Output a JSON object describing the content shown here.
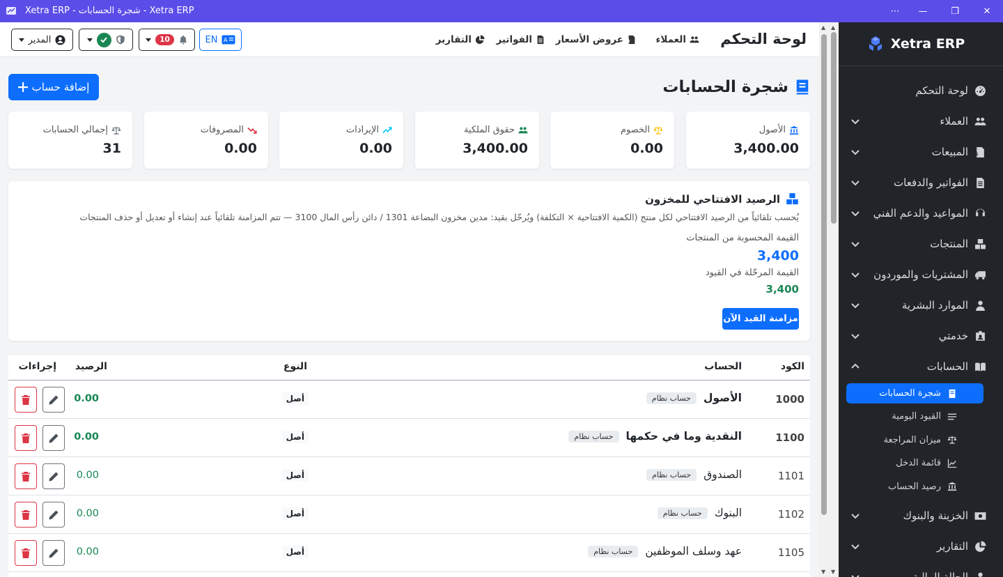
{
  "window": {
    "title": "Xetra ERP - شجرة الحسابات - Xetra ERP",
    "controls": [
      "⋯",
      "—",
      "❐",
      "✕"
    ]
  },
  "sidebar": {
    "brand": "Xetra ERP",
    "items": [
      {
        "label": "لوحة التحكم",
        "icon": "gauge-icon",
        "chevron": false
      },
      {
        "label": "العملاء",
        "icon": "users-icon",
        "chevron": "down"
      },
      {
        "label": "المبيعات",
        "icon": "file-dollar-icon",
        "chevron": "down"
      },
      {
        "label": "الفواتير والدفعات",
        "icon": "invoice-icon",
        "chevron": "down"
      },
      {
        "label": "المواعيد والدعم الفني",
        "icon": "headset-icon",
        "chevron": "down"
      },
      {
        "label": "المنتجات",
        "icon": "boxes-icon",
        "chevron": "down"
      },
      {
        "label": "المشتريات والموردون",
        "icon": "truck-icon",
        "chevron": "down"
      },
      {
        "label": "الموارد البشرية",
        "icon": "user-tie-icon",
        "chevron": "down"
      },
      {
        "label": "خدمتي",
        "icon": "id-badge-icon",
        "chevron": "down"
      },
      {
        "label": "الحسابات",
        "icon": "book-open-icon",
        "chevron": "up"
      }
    ],
    "sub_items": [
      {
        "label": "شجرة الحسابات",
        "icon": "book-icon",
        "active": true
      },
      {
        "label": "القيود اليومية",
        "icon": "list-icon",
        "active": false
      },
      {
        "label": "ميزان المراجعة",
        "icon": "scale-icon",
        "active": false
      },
      {
        "label": "قائمة الدخل",
        "icon": "chart-line-icon",
        "active": false
      },
      {
        "label": "رصيد الحساب",
        "icon": "bank-icon",
        "active": false
      }
    ],
    "items_after": [
      {
        "label": "الخزينة والبنوك",
        "icon": "money-icon",
        "chevron": "down"
      },
      {
        "label": "التقارير",
        "icon": "pie-chart-icon",
        "chevron": "down"
      },
      {
        "label": "الحالة المالية",
        "icon": "person-icon",
        "chevron": "down"
      }
    ]
  },
  "topbar": {
    "page_title": "لوحة التحكم",
    "nav": [
      {
        "label": "العملاء",
        "icon": "users-icon"
      },
      {
        "label": "عروض الأسعار",
        "icon": "file-dollar-icon"
      },
      {
        "label": "الفواتير",
        "icon": "invoice-icon"
      },
      {
        "label": "التقارير",
        "icon": "pie-chart-icon"
      }
    ],
    "lang_label": "EN",
    "notification_count": "10",
    "user_label": "المدير"
  },
  "page": {
    "title": "شجرة الحسابات",
    "add_button": "إضافة حساب"
  },
  "summary_cards": [
    {
      "label": "الأصول",
      "value": "3,400.00",
      "icon": "bank-icon",
      "color": "#0d6efd"
    },
    {
      "label": "الخصوم",
      "value": "0.00",
      "icon": "scale-icon",
      "color": "#ffc107"
    },
    {
      "label": "حقوق الملكية",
      "value": "3,400.00",
      "icon": "users-icon",
      "color": "#198754"
    },
    {
      "label": "الإيرادات",
      "value": "0.00",
      "icon": "trend-up-icon",
      "color": "#0dcaf0"
    },
    {
      "label": "المصروفات",
      "value": "0.00",
      "icon": "trend-down-icon",
      "color": "#dc3545"
    },
    {
      "label": "إجمالي الحسابات",
      "value": "31",
      "icon": "scale-icon",
      "color": "#6c757d"
    }
  ],
  "inventory": {
    "title": "الرصيد الافتتاحي للمخزون",
    "description": "يُحسب تلقائياً من الرصيد الافتتاحي لكل منتج (الكمية الافتتاحية × التكلفة) ويُرحّل بقيد: مدين مخزون البضاعة 1301 / دائن رأس المال 3100 — تتم المزامنة تلقائياً عند إنشاء أو تعديل أو حذف المنتجات",
    "computed_label": "القيمة المحسوبة من المنتجات",
    "computed_value": "3,400",
    "posted_label": "القيمة المرحّلة في القيود",
    "posted_value": "3,400",
    "sync_button": "مزامنة القيد الآن"
  },
  "table": {
    "headers": {
      "code": "الكود",
      "account": "الحساب",
      "type": "النوع",
      "balance": "الرصيد",
      "actions": "إجراءات"
    },
    "system_tag": "حساب نظام",
    "rows": [
      {
        "code": "1000",
        "name": "الأصول",
        "type": "أصل",
        "balance": "0.00",
        "bold": true
      },
      {
        "code": "1100",
        "name": "النقدية وما في حكمها",
        "type": "أصل",
        "balance": "0.00",
        "bold": true
      },
      {
        "code": "1101",
        "name": "الصندوق",
        "type": "أصل",
        "balance": "0.00",
        "bold": false
      },
      {
        "code": "1102",
        "name": "البنوك",
        "type": "أصل",
        "balance": "0.00",
        "bold": false
      },
      {
        "code": "1105",
        "name": "عهد وسلف الموظفين",
        "type": "أصل",
        "balance": "0.00",
        "bold": false
      }
    ]
  }
}
